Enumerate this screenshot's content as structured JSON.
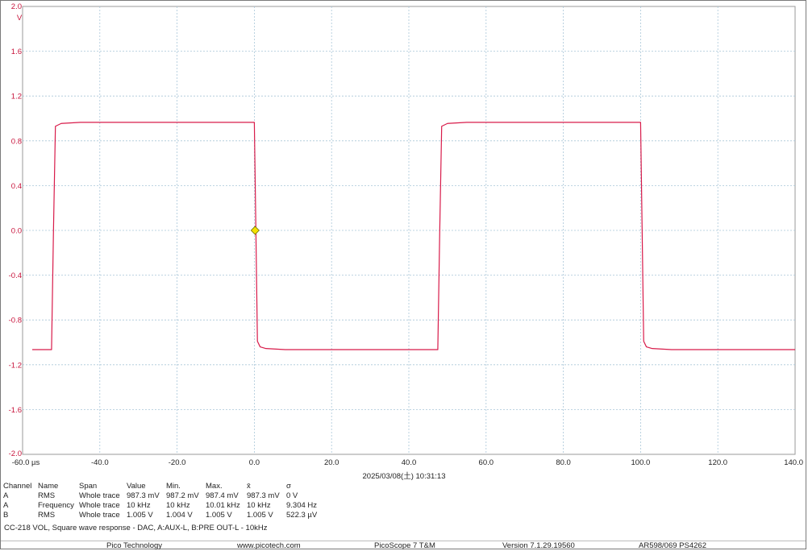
{
  "chart_data": {
    "type": "line",
    "xlim": [
      -60,
      140
    ],
    "ylim": [
      -2.0,
      2.0
    ],
    "x_ticks": [
      "-60.0 µs",
      "-40.0",
      "-20.0",
      "0.0",
      "20.0",
      "40.0",
      "60.0",
      "80.0",
      "100.0",
      "120.0",
      "140.0"
    ],
    "x_tick_values": [
      -60,
      -40,
      -20,
      0,
      20,
      40,
      60,
      80,
      100,
      120,
      140
    ],
    "y_ticks": [
      "2.0",
      "1.6",
      "1.2",
      "0.8",
      "0.4",
      "0.0",
      "-0.4",
      "-0.8",
      "-1.2",
      "-1.6",
      "-2.0"
    ],
    "y_tick_values": [
      2.0,
      1.6,
      1.2,
      0.8,
      0.4,
      0.0,
      -0.4,
      -0.8,
      -1.2,
      -1.6,
      -2.0
    ],
    "y_unit": "V",
    "grid": true,
    "series": [
      {
        "color": "#d81b4a",
        "x": [
          -57.5,
          -52.5,
          -52.0,
          -51.5,
          -50.0,
          -45.0,
          0.0,
          0.4,
          0.8,
          1.5,
          3.0,
          8.0,
          47.5,
          48.0,
          48.5,
          50.0,
          55.0,
          100.0,
          100.4,
          100.8,
          101.5,
          103.0,
          108.0,
          140.0
        ],
        "values": [
          -1.065,
          -1.065,
          0.0,
          0.93,
          0.955,
          0.965,
          0.965,
          0.0,
          -0.99,
          -1.04,
          -1.055,
          -1.065,
          -1.065,
          0.0,
          0.93,
          0.955,
          0.965,
          0.965,
          0.0,
          -0.99,
          -1.04,
          -1.055,
          -1.065,
          -1.065
        ]
      }
    ],
    "trigger_marker": {
      "x": 0.2,
      "y": 0.0,
      "color": "#f4e100"
    }
  },
  "timestamp": "2025/03/08(土) 10:31:13",
  "measurements": {
    "headers": [
      "Channel",
      "Name",
      "Span",
      "Value",
      "Min.",
      "Max.",
      "x̄",
      "σ"
    ],
    "rows": [
      [
        "A",
        "RMS",
        "Whole trace",
        "987.3 mV",
        "987.2 mV",
        "987.4 mV",
        "987.3 mV",
        "0 V"
      ],
      [
        "A",
        "Frequency",
        "Whole trace",
        "10 kHz",
        "10 kHz",
        "10.01 kHz",
        "10 kHz",
        "9.304 Hz"
      ],
      [
        "B",
        "RMS",
        "Whole trace",
        "1.005 V",
        "1.004 V",
        "1.005 V",
        "1.005 V",
        "522.3 µV"
      ]
    ]
  },
  "caption": "CC-218 VOL, Square wave response - DAC, A:AUX-L, B:PRE OUT-L - 10kHz",
  "footer": {
    "company": "Pico Technology",
    "website": "www.picotech.com",
    "product": "PicoScope 7 T&M",
    "version": "Version 7.1.29.19560",
    "device": "AR598/069 PS4262"
  }
}
